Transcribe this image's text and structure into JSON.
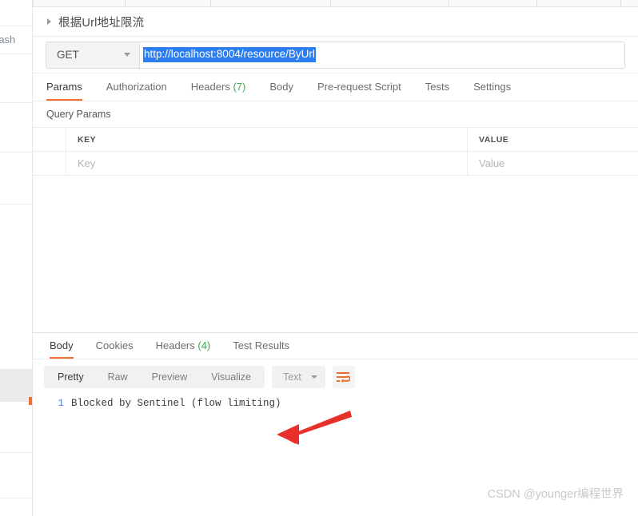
{
  "left_panel": {
    "truncated_item_label": "rash"
  },
  "request": {
    "title": "根据Url地址限流",
    "collapse_icon": "caret-right-icon",
    "method": "GET",
    "method_caret_icon": "chevron-down-icon",
    "url": "http://localhost:8004/resource/ByUrl",
    "url_selected": true,
    "tabs": [
      {
        "label": "Params",
        "count": "",
        "active": true
      },
      {
        "label": "Authorization",
        "count": "",
        "active": false
      },
      {
        "label": "Headers",
        "count": "(7)",
        "active": false
      },
      {
        "label": "Body",
        "count": "",
        "active": false
      },
      {
        "label": "Pre-request Script",
        "count": "",
        "active": false
      },
      {
        "label": "Tests",
        "count": "",
        "active": false
      },
      {
        "label": "Settings",
        "count": "",
        "active": false
      }
    ],
    "query_params_label": "Query Params",
    "params_table": {
      "headers": [
        "KEY",
        "VALUE"
      ],
      "placeholder_row": [
        "Key",
        "Value"
      ]
    }
  },
  "response": {
    "tabs": [
      {
        "label": "Body",
        "count": "",
        "active": true
      },
      {
        "label": "Cookies",
        "count": "",
        "active": false
      },
      {
        "label": "Headers",
        "count": "(4)",
        "active": false
      },
      {
        "label": "Test Results",
        "count": "",
        "active": false
      }
    ],
    "view_modes": [
      {
        "label": "Pretty",
        "active": true
      },
      {
        "label": "Raw",
        "active": false
      },
      {
        "label": "Preview",
        "active": false
      },
      {
        "label": "Visualize",
        "active": false
      }
    ],
    "format": "Text",
    "format_caret_icon": "chevron-down-icon",
    "wrap_icon": "wrap-lines-icon",
    "body": {
      "line_number": "1",
      "text": "Blocked by Sentinel (flow limiting)"
    }
  },
  "annotation": {
    "arrow_icon": "red-arrow-icon",
    "color": "#e8312a"
  },
  "watermark": "CSDN @younger编程世界",
  "colors": {
    "accent": "#ef6c2e",
    "selection_blue": "#2a7ef0",
    "count_green": "#3aab4e",
    "line_number_blue": "#4a7fd4"
  }
}
